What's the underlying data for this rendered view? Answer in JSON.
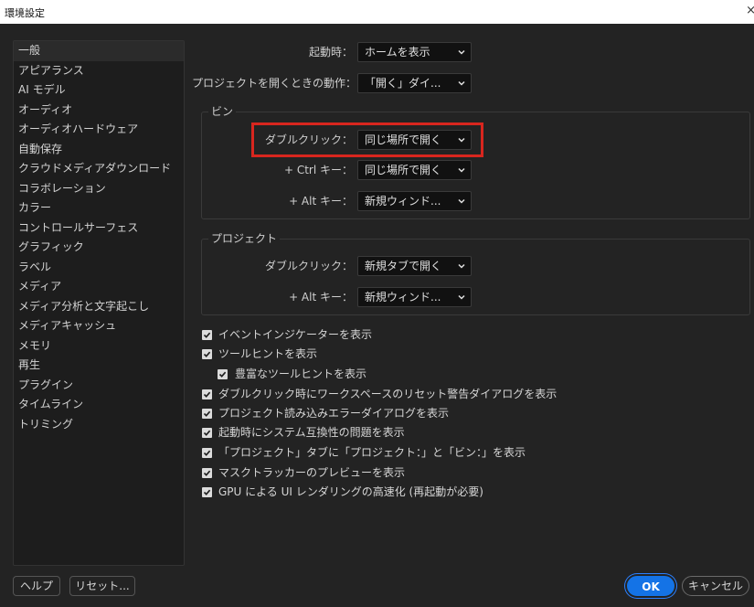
{
  "window": {
    "title": "環境設定",
    "close_glyph": "×"
  },
  "sidebar": {
    "items": [
      {
        "label": "一般",
        "selected": true
      },
      {
        "label": "アピアランス"
      },
      {
        "label": "AI モデル"
      },
      {
        "label": "オーディオ"
      },
      {
        "label": "オーディオハードウェア"
      },
      {
        "label": "自動保存"
      },
      {
        "label": "クラウドメディアダウンロード"
      },
      {
        "label": "コラボレーション"
      },
      {
        "label": "カラー"
      },
      {
        "label": "コントロールサーフェス"
      },
      {
        "label": "グラフィック"
      },
      {
        "label": "ラベル"
      },
      {
        "label": "メディア"
      },
      {
        "label": "メディア分析と文字起こし"
      },
      {
        "label": "メディアキャッシュ"
      },
      {
        "label": "メモリ"
      },
      {
        "label": "再生"
      },
      {
        "label": "プラグイン"
      },
      {
        "label": "タイムライン"
      },
      {
        "label": "トリミング"
      }
    ]
  },
  "general": {
    "startup": {
      "label": "起動時：",
      "value": "ホームを表示"
    },
    "open_project": {
      "label": "プロジェクトを開くときの動作：",
      "value": "「開く」ダイ..."
    }
  },
  "bin_group": {
    "title": "ビン",
    "double_click": {
      "label": "ダブルクリック：",
      "value": "同じ場所で開く"
    },
    "ctrl": {
      "label": "+ Ctrl キー：",
      "value": "同じ場所で開く"
    },
    "alt": {
      "label": "+ Alt キー：",
      "value": "新規ウィンド..."
    }
  },
  "project_group": {
    "title": "プロジェクト",
    "double_click": {
      "label": "ダブルクリック：",
      "value": "新規タブで開く"
    },
    "alt": {
      "label": "+ Alt キー：",
      "value": "新規ウィンド..."
    }
  },
  "checkboxes": [
    {
      "label": "イベントインジケーターを表示",
      "checked": true
    },
    {
      "label": "ツールヒントを表示",
      "checked": true
    },
    {
      "label": "豊富なツールヒントを表示",
      "checked": true,
      "indent": true
    },
    {
      "label": "ダブルクリック時にワークスペースのリセット警告ダイアログを表示",
      "checked": true
    },
    {
      "label": "プロジェクト読み込みエラーダイアログを表示",
      "checked": true
    },
    {
      "label": "起動時にシステム互換性の問題を表示",
      "checked": true
    },
    {
      "label": "「プロジェクト」タブに「プロジェクト：」と「ビン：」を表示",
      "checked": true
    },
    {
      "label": "マスクトラッカーのプレビューを表示",
      "checked": true
    },
    {
      "label": "GPU による UI レンダリングの高速化 (再起動が必要)",
      "checked": true
    }
  ],
  "footer": {
    "help": "ヘルプ",
    "reset": "リセット...",
    "ok": "OK",
    "cancel": "キャンセル"
  },
  "colors": {
    "accent": "#1473e6",
    "highlight": "#d8261e",
    "background": "#232323"
  }
}
